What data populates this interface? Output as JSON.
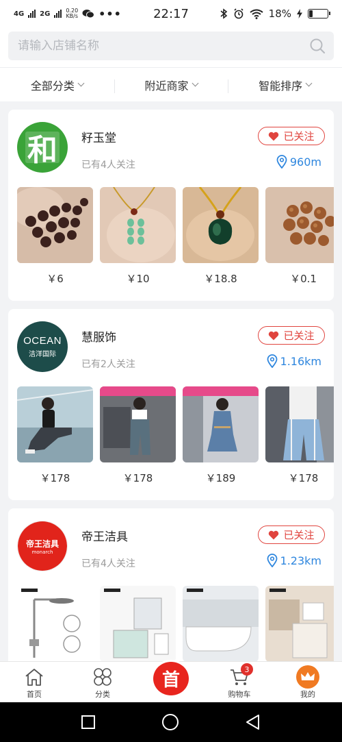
{
  "status_bar": {
    "net1": "4G",
    "net2": "2G",
    "speed_value": "0.20",
    "speed_unit": "KB/s",
    "time": "22:17",
    "battery": "18%",
    "battery_level": 0.18
  },
  "search": {
    "placeholder": "请输入店铺名称"
  },
  "filters": [
    {
      "label": "全部分类"
    },
    {
      "label": "附近商家"
    },
    {
      "label": "智能排序"
    }
  ],
  "shops": [
    {
      "name": "籽玉堂",
      "logo_text": "和",
      "followers": "已有4人关注",
      "follow_label": "已关注",
      "distance": "960m",
      "products": [
        {
          "price": "￥6"
        },
        {
          "price": "￥10"
        },
        {
          "price": "￥18.8"
        },
        {
          "price": "￥0.1"
        }
      ]
    },
    {
      "name": "慧服饰",
      "logo_text": "OCEAN",
      "logo_subtext": "洁洋国际",
      "followers": "已有2人关注",
      "follow_label": "已关注",
      "distance": "1.16km",
      "products": [
        {
          "price": "￥178"
        },
        {
          "price": "￥178"
        },
        {
          "price": "￥189"
        },
        {
          "price": "￥178"
        }
      ]
    },
    {
      "name": "帝王洁具",
      "logo_text": "帝王洁具",
      "logo_subtext": "monarch",
      "followers": "已有4人关注",
      "follow_label": "已关注",
      "distance": "1.23km",
      "products": [
        {
          "price": ""
        },
        {
          "price": ""
        },
        {
          "price": ""
        },
        {
          "price": ""
        }
      ]
    }
  ],
  "tabbar": {
    "home": "首页",
    "category": "分类",
    "center_glyph": "首",
    "cart": "购物车",
    "cart_count": "3",
    "mine": "我的"
  },
  "colors": {
    "accent_red": "#e0443e",
    "link_blue": "#2e86de",
    "mine_orange": "#f07a22"
  }
}
